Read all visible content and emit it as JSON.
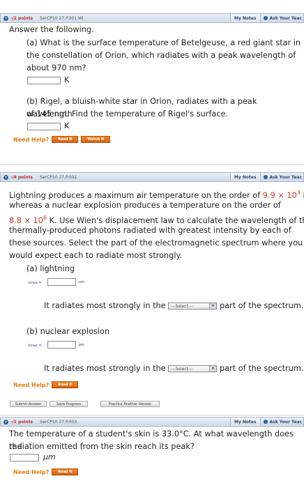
{
  "q1": {
    "header": {
      "points": "-/2 points",
      "id": "SerCP10 27.P.001.WI.",
      "my_notes": "My Notes",
      "ask": "Ask Your Teac"
    },
    "instruction": "Answer the following.",
    "a_text_1": "(a) What is the surface temperature of Betelgeuse, a red giant star in",
    "a_text_2": "the constellation of Orion, which radiates with a peak wavelength of",
    "a_text_3": "about 970 nm?",
    "a_unit": "K",
    "b_text_1": "(b) Rigel, a bluish-white star in Orion, radiates with a peak wavelength",
    "b_text_2": "of 145 nm. Find the temperature of Rigel's surface.",
    "b_unit": "K",
    "need_help": "Need Help?",
    "read_it": "Read It",
    "watch_it": "Watch It"
  },
  "q2": {
    "header": {
      "points": "-/4 points",
      "id": "SerCP10 27.P.002.",
      "my_notes": "My Notes",
      "ask": "Ask Your Teac"
    },
    "line1_pre": "Lightning produces a maximum air temperature on the order of ",
    "line1_val": "9.9 × 10",
    "line1_exp": "3",
    "line1_post": " K,",
    "line2": "whereas a nuclear explosion produces a temperature on the order of",
    "line3_val": "8.8 × 10",
    "line3_exp": "6",
    "line3_post": " K. Use Wien's displacement law to calculate the wavelength of the",
    "line4": "thermally-produced photons radiated with greatest intensity by each of",
    "line5": "these sources. Select the part of the electromagnetic spectrum where you",
    "line6": "would expect each to radiate most strongly.",
    "a_label": "(a) lightning",
    "lambda_label": "λmax =",
    "a_unit": "nm",
    "radiates_pre": "It radiates most strongly in the",
    "select_value": "---Select---",
    "radiates_post": "part of the spectrum.",
    "b_label": "(b) nuclear explosion",
    "b_unit": "pm",
    "need_help": "Need Help?",
    "read_it": "Read It"
  },
  "actions": {
    "submit": "Submit Answer",
    "save": "Save Progress",
    "practice": "Practice Another Version"
  },
  "q3": {
    "header": {
      "points": "-/1 points",
      "id": "SerCP10 27.P.003.",
      "my_notes": "My Notes",
      "ask": "Ask Your Teac"
    },
    "line1": "The temperature of a student's skin is 33.0°C. At what wavelength does the",
    "line2": "radiation emitted from the skin reach its peak?",
    "unit": "µm",
    "need_help": "Need Help?",
    "read_it": "Read It"
  }
}
